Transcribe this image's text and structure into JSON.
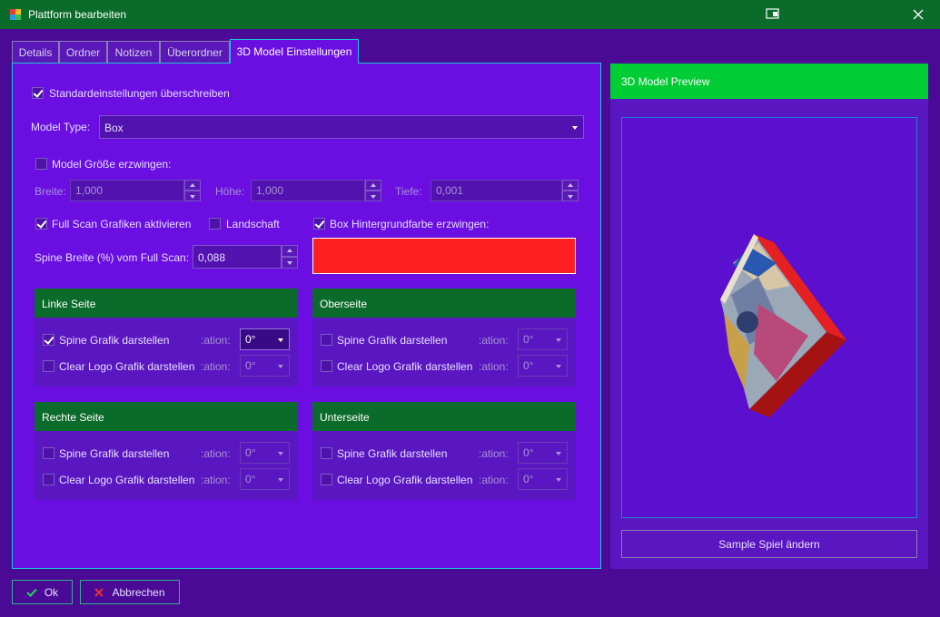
{
  "window": {
    "title": "Plattform bearbeiten"
  },
  "tabs": [
    "Details",
    "Ordner",
    "Notizen",
    "Überordner",
    "3D Model Einstellungen"
  ],
  "settings": {
    "override_label": "Standardeinstellungen überschreiben",
    "override_checked": true,
    "model_type_label": "Model Type:",
    "model_type_value": "Box",
    "force_size_label": "Model Größe erzwingen:",
    "force_size_checked": false,
    "width_label": "Breite:",
    "width_value": "1,000",
    "height_label": "Höhe:",
    "height_value": "1,000",
    "depth_label": "Tiefe:",
    "depth_value": "0,001",
    "fullscan_label": "Full Scan Grafiken aktivieren",
    "fullscan_checked": true,
    "landscape_label": "Landschaft",
    "landscape_checked": false,
    "bgcolor_label": "Box Hintergrundfarbe erzwingen:",
    "bgcolor_checked": true,
    "bgcolor_value": "#ff2121",
    "spine_width_label": "Spine Breite (%) vom Full Scan:",
    "spine_width_value": "0,088"
  },
  "groups": {
    "left": {
      "title": "Linke Seite",
      "spine_label": "Spine Grafik darstellen",
      "spine_checked": true,
      "logo_label": "Clear Logo Grafik darstellen",
      "logo_checked": false,
      "rot_label": ":ation:",
      "spine_rot": "0°",
      "logo_rot": "0°"
    },
    "top": {
      "title": "Oberseite",
      "spine_label": "Spine Grafik darstellen",
      "spine_checked": false,
      "logo_label": "Clear Logo Grafik darstellen",
      "logo_checked": false,
      "rot_label": ":ation:",
      "spine_rot": "0°",
      "logo_rot": "0°"
    },
    "right": {
      "title": "Rechte Seite",
      "spine_label": "Spine Grafik darstellen",
      "spine_checked": false,
      "logo_label": "Clear Logo Grafik darstellen",
      "logo_checked": false,
      "rot_label": ":ation:",
      "spine_rot": "0°",
      "logo_rot": "0°"
    },
    "bottom": {
      "title": "Unterseite",
      "spine_label": "Spine Grafik darstellen",
      "spine_checked": false,
      "logo_label": "Clear Logo Grafik darstellen",
      "logo_checked": false,
      "rot_label": ":ation:",
      "spine_rot": "0°",
      "logo_rot": "0°"
    }
  },
  "preview": {
    "title": "3D Model Preview",
    "change_sample_label": "Sample Spiel ändern"
  },
  "footer": {
    "ok_label": "Ok",
    "cancel_label": "Abbrechen"
  },
  "colors": {
    "titlebar": "#0a6b2a",
    "panel": "#6a0ee2",
    "accent_green": "#00cc33",
    "box_color": "#ff2121"
  }
}
